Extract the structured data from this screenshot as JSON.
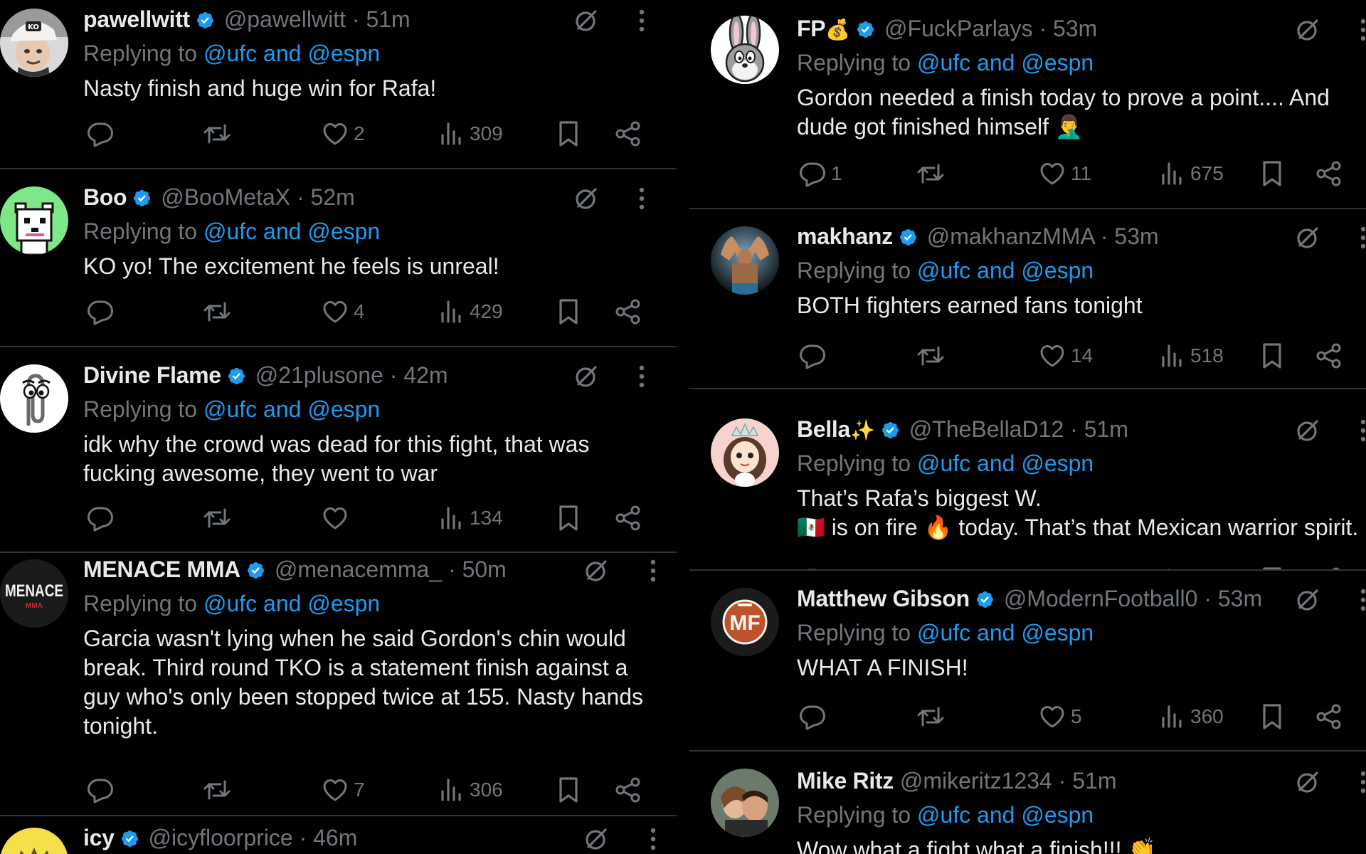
{
  "colors": {
    "background": "#000000",
    "text": "#e7e9ea",
    "muted": "#71767b",
    "link": "#1d9bf0",
    "verified": "#1d9bf0",
    "divider": "#2f3336"
  },
  "icons": {
    "verified": "verified-badge-icon",
    "grok": "grok-icon",
    "more": "more-options-icon",
    "reply": "reply-icon",
    "repost": "repost-icon",
    "like": "like-icon",
    "views": "views-icon",
    "bookmark": "bookmark-icon",
    "share": "share-icon"
  },
  "common": {
    "replying_prefix": "Replying to ",
    "replying_targets": "@ufc and @espn",
    "dot": " · "
  },
  "left_column": [
    {
      "name": "pawellwitt",
      "handle": "@pawellwitt",
      "time": "51m",
      "text": "Nasty finish and huge win for Rafa!",
      "replies": "",
      "reposts": "",
      "likes": "2",
      "views": "309",
      "avatar": "avatar-ko-cap-man"
    },
    {
      "name": "Boo",
      "handle": "@BooMetaX",
      "time": "52m",
      "text": "KO yo! The excitement he feels is unreal!",
      "replies": "",
      "reposts": "",
      "likes": "4",
      "views": "429",
      "avatar": "avatar-pixel-dog"
    },
    {
      "name": "Divine Flame",
      "handle": "@21plusone",
      "time": "42m",
      "text": "idk why the crowd was dead for this fight, that was fucking awesome, they went to war",
      "replies": "",
      "reposts": "",
      "likes": "",
      "views": "134",
      "avatar": "avatar-paperclip"
    },
    {
      "name": "MENACE MMA",
      "handle": "@menacemma_",
      "time": "50m",
      "text": "Garcia wasn't lying when he said Gordon's chin would break. Third round TKO is a statement finish against a guy who's only been stopped twice at 155. Nasty hands tonight.",
      "replies": "",
      "reposts": "",
      "likes": "7",
      "views": "306",
      "avatar": "avatar-menace-logo",
      "avatar_text": "MENACE",
      "avatar_subtext": "MMA"
    },
    {
      "name": "icy",
      "handle": "@icyfloorprice",
      "time": "46m",
      "text": "",
      "avatar": "avatar-yellow-crown"
    }
  ],
  "right_column": [
    {
      "name": "FP",
      "name_emoji": "💰",
      "handle": "@FuckParlays",
      "time": "53m",
      "text": "Gordon needed a finish today to prove a point.... And dude got finished himself 🤦‍♂️",
      "replies": "1",
      "reposts": "",
      "likes": "11",
      "views": "675",
      "avatar": "avatar-bugs-bunny"
    },
    {
      "name": "makhanz",
      "handle": "@makhanzMMA",
      "time": "53m",
      "text": "BOTH fighters earned fans tonight",
      "replies": "",
      "reposts": "",
      "likes": "14",
      "views": "518",
      "avatar": "avatar-fighter-photo"
    },
    {
      "name": "Bella",
      "name_emoji": "✨",
      "handle": "@TheBellaD12",
      "time": "51m",
      "text": "That’s Rafa’s biggest W.\n🇲🇽 is on fire 🔥 today. That’s that Mexican warrior spirit.",
      "replies": "",
      "reposts": "",
      "likes": "",
      "views": "",
      "avatar": "avatar-princess-cartoon"
    },
    {
      "name": "Matthew Gibson",
      "handle": "@ModernFootball0",
      "time": "53m",
      "text": "WHAT A FINISH!",
      "replies": "",
      "reposts": "",
      "likes": "5",
      "views": "360",
      "avatar": "avatar-mf-logo",
      "avatar_text": "MF"
    },
    {
      "name": "Mike Ritz",
      "handle": "@mikeritz1234",
      "time": "51m",
      "text": "Wow what a fight what a finish!!! 👏",
      "avatar": "avatar-couple-photo"
    }
  ]
}
